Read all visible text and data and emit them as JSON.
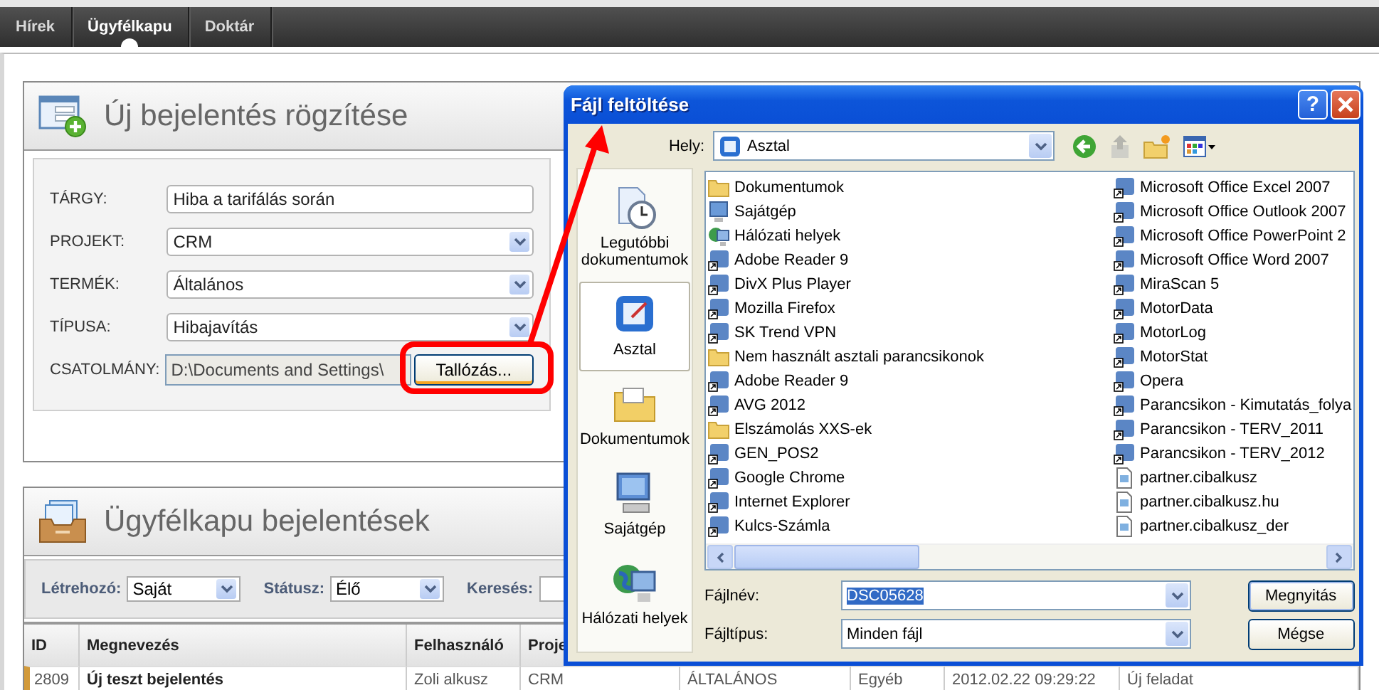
{
  "nav": {
    "tabs": [
      {
        "label": "Hírek",
        "selected": false
      },
      {
        "label": "Ügyfélkapu",
        "selected": true
      },
      {
        "label": "Doktár",
        "selected": false
      }
    ]
  },
  "new_ticket": {
    "title": "Új bejelentés rögzítése",
    "fields": [
      {
        "label": "TÁRGY:",
        "kind": "text",
        "value": "Hiba a tarifálás során"
      },
      {
        "label": "PROJEKT:",
        "kind": "select",
        "value": "CRM"
      },
      {
        "label": "TERMÉK:",
        "kind": "select",
        "value": "Általános"
      },
      {
        "label": "TÍPUSA:",
        "kind": "select",
        "value": "Hibajavítás"
      },
      {
        "label": "CSATOLMÁNY:",
        "kind": "file",
        "value": "D:\\Documents and Settings\\",
        "button": "Tallózás..."
      }
    ]
  },
  "tickets": {
    "title": "Ügyfélkapu bejelentések",
    "filters": [
      {
        "label": "Létrehozó:",
        "kind": "select",
        "value": "Saját"
      },
      {
        "label": "Státusz:",
        "kind": "select",
        "value": "Élő"
      },
      {
        "label": "Keresés:",
        "kind": "text"
      }
    ],
    "table": {
      "columns": [
        "ID",
        "Megnevezés",
        "Felhasználó",
        "Proje"
      ],
      "rows": [
        {
          "cells": [
            "2809",
            "Új teszt bejelentés",
            "Zoli alkusz",
            "CRM",
            "ÁLTALÁNOS",
            "Egyéb",
            "2012.02.22 09:29:22",
            "Új feladat"
          ]
        }
      ]
    }
  },
  "dialog": {
    "title": "Fájl feltöltése",
    "help_button": "?",
    "location_label": "Hely:",
    "location": "Asztal",
    "places": [
      {
        "label": "Legutóbbi dokumentumok",
        "kind": "recent",
        "selected": false
      },
      {
        "label": "Asztal",
        "kind": "desktop",
        "selected": true
      },
      {
        "label": "Dokumentumok",
        "kind": "documents",
        "selected": false
      },
      {
        "label": "Sajátgép",
        "kind": "computer",
        "selected": false
      },
      {
        "label": "Hálózati helyek",
        "kind": "network",
        "selected": false
      }
    ],
    "files": [
      {
        "name": "Dokumentumok",
        "kind": "folder"
      },
      {
        "name": "Sajátgép",
        "kind": "computer"
      },
      {
        "name": "Hálózati helyek",
        "kind": "network"
      },
      {
        "name": "Adobe Reader 9",
        "kind": "app"
      },
      {
        "name": "DivX Plus Player",
        "kind": "app"
      },
      {
        "name": "Mozilla Firefox",
        "kind": "app"
      },
      {
        "name": "SK Trend VPN",
        "kind": "app"
      },
      {
        "name": "Nem használt asztali parancsikonok",
        "kind": "folder"
      },
      {
        "name": "Adobe Reader 9",
        "kind": "app"
      },
      {
        "name": "AVG 2012",
        "kind": "app"
      },
      {
        "name": "Elszámolás XXS-ek",
        "kind": "folder"
      },
      {
        "name": "GEN_POS2",
        "kind": "app"
      },
      {
        "name": "Google Chrome",
        "kind": "app"
      },
      {
        "name": "Internet Explorer",
        "kind": "app"
      },
      {
        "name": "Kulcs-Számla",
        "kind": "app"
      },
      {
        "name": "Microsoft Office Excel 2007",
        "kind": "app"
      },
      {
        "name": "Microsoft Office Outlook 2007",
        "kind": "app"
      },
      {
        "name": "Microsoft Office PowerPoint 2",
        "kind": "app"
      },
      {
        "name": "Microsoft Office Word 2007",
        "kind": "app"
      },
      {
        "name": "MiraScan 5",
        "kind": "app"
      },
      {
        "name": "MotorData",
        "kind": "app"
      },
      {
        "name": "MotorLog",
        "kind": "app"
      },
      {
        "name": "MotorStat",
        "kind": "app"
      },
      {
        "name": "Opera",
        "kind": "app"
      },
      {
        "name": "Parancsikon - Kimutatás_folya",
        "kind": "app"
      },
      {
        "name": "Parancsikon - TERV_2011",
        "kind": "app"
      },
      {
        "name": "Parancsikon - TERV_2012",
        "kind": "app"
      },
      {
        "name": "partner.cibalkusz",
        "kind": "document"
      },
      {
        "name": "partner.cibalkusz.hu",
        "kind": "document"
      },
      {
        "name": "partner.cibalkusz_der",
        "kind": "document"
      }
    ],
    "filename_label": "Fájlnév:",
    "filename": "DSC05628",
    "filename_selected": true,
    "filetype_label": "Fájltípus:",
    "filetype": "Minden fájl",
    "buttons": [
      "Megnyitás",
      "Mégse"
    ]
  }
}
